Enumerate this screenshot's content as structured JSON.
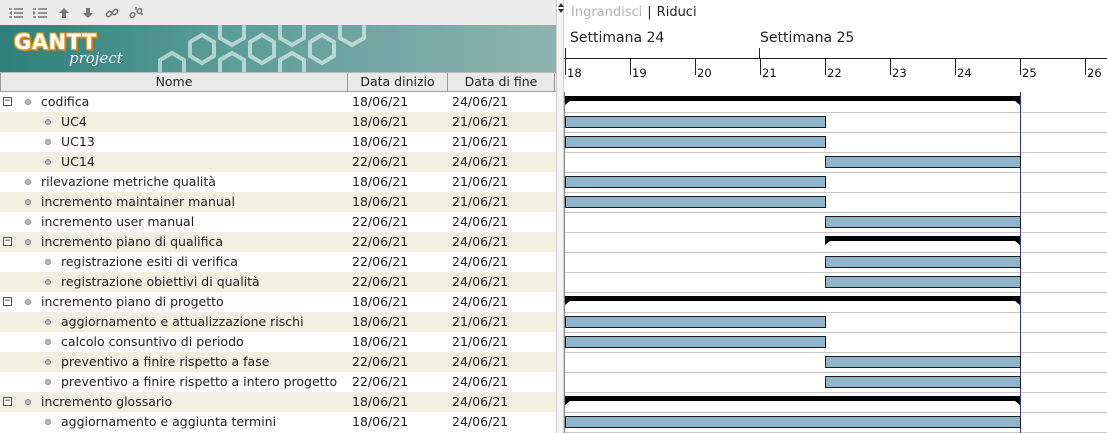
{
  "toolbar": {
    "buttons": [
      {
        "icon": "unindent-icon"
      },
      {
        "icon": "indent-icon"
      },
      {
        "icon": "move-up-icon"
      },
      {
        "icon": "move-down-icon"
      },
      {
        "icon": "link-icon"
      },
      {
        "icon": "unlink-icon"
      }
    ]
  },
  "logo": {
    "word1": "GANTT",
    "word2": "project"
  },
  "columns": {
    "name": "Nome",
    "start": "Data dinizio",
    "end": "Data di fine"
  },
  "zoom": {
    "zoom_in": "Ingrandisci",
    "separator": "|",
    "zoom_out": "Riduci"
  },
  "weeks": [
    "Settimana  24",
    "Settimana  25"
  ],
  "days": [
    "18",
    "19",
    "20",
    "21",
    "22",
    "23",
    "24",
    "25",
    "26"
  ],
  "colors": {
    "bar": "#8fb4cc",
    "summary": "#000000",
    "today_line": "#3232a0",
    "alt_row": "#f0f0e0"
  },
  "tasks": [
    {
      "name": "codifica",
      "start": "18/06/21",
      "end": "24/06/21",
      "level": 0,
      "group": true,
      "expander": "−",
      "bar_start_day": 18,
      "bar_end_day": 25
    },
    {
      "name": "UC4",
      "start": "18/06/21",
      "end": "21/06/21",
      "level": 1,
      "group": false,
      "bar_start_day": 18,
      "bar_end_day": 22
    },
    {
      "name": "UC13",
      "start": "18/06/21",
      "end": "21/06/21",
      "level": 1,
      "group": false,
      "bar_start_day": 18,
      "bar_end_day": 22
    },
    {
      "name": "UC14",
      "start": "22/06/21",
      "end": "24/06/21",
      "level": 1,
      "group": false,
      "bar_start_day": 22,
      "bar_end_day": 25
    },
    {
      "name": "rilevazione metriche qualità",
      "start": "18/06/21",
      "end": "21/06/21",
      "level": 0,
      "group": false,
      "bar_start_day": 18,
      "bar_end_day": 22
    },
    {
      "name": "incremento maintainer manual",
      "start": "18/06/21",
      "end": "21/06/21",
      "level": 0,
      "group": false,
      "bar_start_day": 18,
      "bar_end_day": 22
    },
    {
      "name": "incremento user manual",
      "start": "22/06/21",
      "end": "24/06/21",
      "level": 0,
      "group": false,
      "bar_start_day": 22,
      "bar_end_day": 25
    },
    {
      "name": "incremento piano di qualifica",
      "start": "22/06/21",
      "end": "24/06/21",
      "level": 0,
      "group": true,
      "expander": "−",
      "bar_start_day": 22,
      "bar_end_day": 25
    },
    {
      "name": "registrazione esiti di verifica",
      "start": "22/06/21",
      "end": "24/06/21",
      "level": 1,
      "group": false,
      "bar_start_day": 22,
      "bar_end_day": 25
    },
    {
      "name": "registrazione obiettivi di qualità",
      "start": "22/06/21",
      "end": "24/06/21",
      "level": 1,
      "group": false,
      "bar_start_day": 22,
      "bar_end_day": 25
    },
    {
      "name": "incremento piano di progetto",
      "start": "18/06/21",
      "end": "24/06/21",
      "level": 0,
      "group": true,
      "expander": "−",
      "bar_start_day": 18,
      "bar_end_day": 25
    },
    {
      "name": "aggiornamento e attualizzazione rischi",
      "start": "18/06/21",
      "end": "21/06/21",
      "level": 1,
      "group": false,
      "bar_start_day": 18,
      "bar_end_day": 22
    },
    {
      "name": "calcolo consuntivo di periodo",
      "start": "18/06/21",
      "end": "21/06/21",
      "level": 1,
      "group": false,
      "bar_start_day": 18,
      "bar_end_day": 22
    },
    {
      "name": "preventivo a finire rispetto a fase",
      "start": "22/06/21",
      "end": "24/06/21",
      "level": 1,
      "group": false,
      "bar_start_day": 22,
      "bar_end_day": 25
    },
    {
      "name": "preventivo a finire rispetto a intero progetto",
      "start": "22/06/21",
      "end": "24/06/21",
      "level": 1,
      "group": false,
      "bar_start_day": 22,
      "bar_end_day": 25
    },
    {
      "name": "incremento glossario",
      "start": "18/06/21",
      "end": "24/06/21",
      "level": 0,
      "group": true,
      "expander": "−",
      "bar_start_day": 18,
      "bar_end_day": 25
    },
    {
      "name": "aggiornamento e aggiunta termini",
      "start": "18/06/21",
      "end": "24/06/21",
      "level": 1,
      "group": false,
      "bar_start_day": 18,
      "bar_end_day": 25
    }
  ]
}
